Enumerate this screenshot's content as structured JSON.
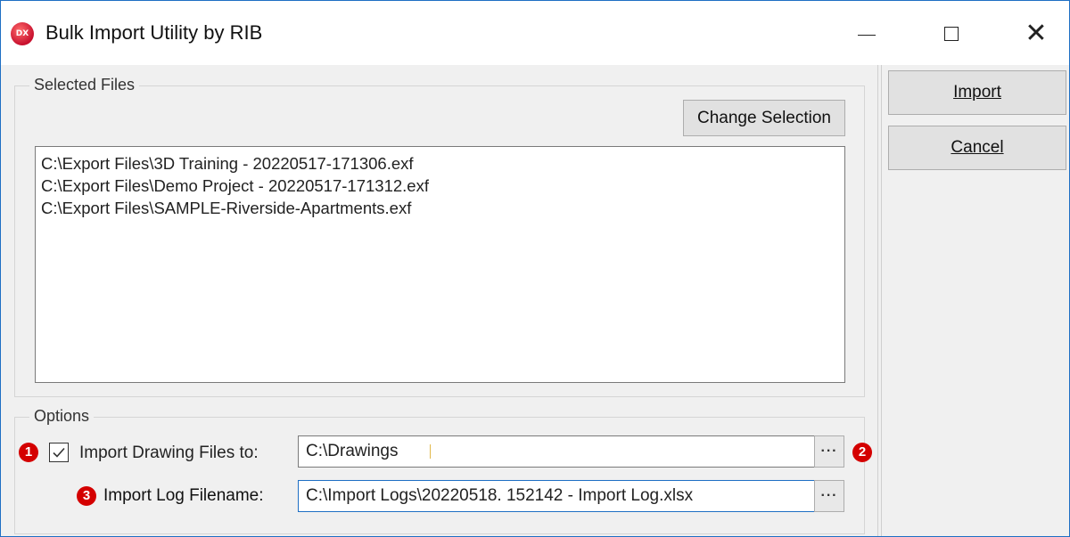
{
  "window": {
    "title": "Bulk Import Utility by RIB",
    "icon_text": "DX",
    "accent": "#1e6fc4"
  },
  "title_buttons": {
    "minimize_icon": "minimize-icon",
    "maximize_icon": "maximize-icon",
    "close_icon": "close-icon",
    "close_glyph": "✕"
  },
  "selected_files": {
    "group_label": "Selected Files",
    "change_selection_label": "Change Selection",
    "files": [
      "C:\\Export Files\\3D Training - 20220517-171306.exf",
      "C:\\Export Files\\Demo Project - 20220517-171312.exf",
      "C:\\Export Files\\SAMPLE-Riverside-Apartments.exf"
    ]
  },
  "actions": {
    "import_label": "Import",
    "cancel_label": "Cancel"
  },
  "options": {
    "group_label": "Options",
    "import_drawings": {
      "checked": true,
      "label": "Import Drawing Files to:",
      "value": "C:\\Drawings",
      "browse_label": "···"
    },
    "import_log": {
      "label": "Import Log Filename:",
      "value": "C:\\Import Logs\\20220518. 152142 - Import Log.xlsx",
      "browse_label": "···"
    }
  },
  "annotations": {
    "badge1": "1",
    "badge2": "2",
    "badge3": "3",
    "color": "#d40000"
  }
}
